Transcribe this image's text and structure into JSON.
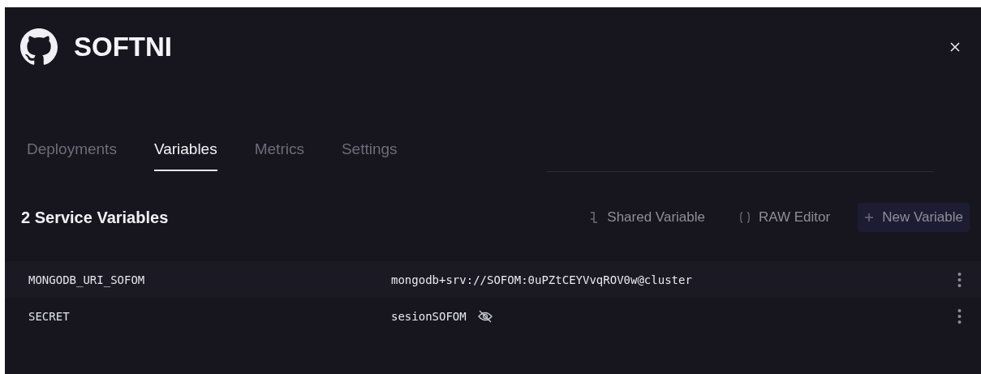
{
  "project": {
    "name": "SOFTNI"
  },
  "tabs": [
    {
      "label": "Deployments",
      "selected": false
    },
    {
      "label": "Variables",
      "selected": true
    },
    {
      "label": "Metrics",
      "selected": false
    },
    {
      "label": "Settings",
      "selected": false
    }
  ],
  "section": {
    "title": "2 Service Variables"
  },
  "actions": [
    {
      "kind": "shared",
      "label": "Shared Variable"
    },
    {
      "kind": "raw",
      "label": "RAW Editor"
    },
    {
      "kind": "new",
      "label": "New Variable"
    }
  ],
  "variables": [
    {
      "name": "MONGODB_URI_SOFOM",
      "value": "mongodb+srv://SOFOM:0uPZtCEYVvqROV0w@cluster",
      "visibility_icon": false
    },
    {
      "name": "SECRET",
      "value": "sesionSOFOM",
      "visibility_icon": true
    }
  ]
}
